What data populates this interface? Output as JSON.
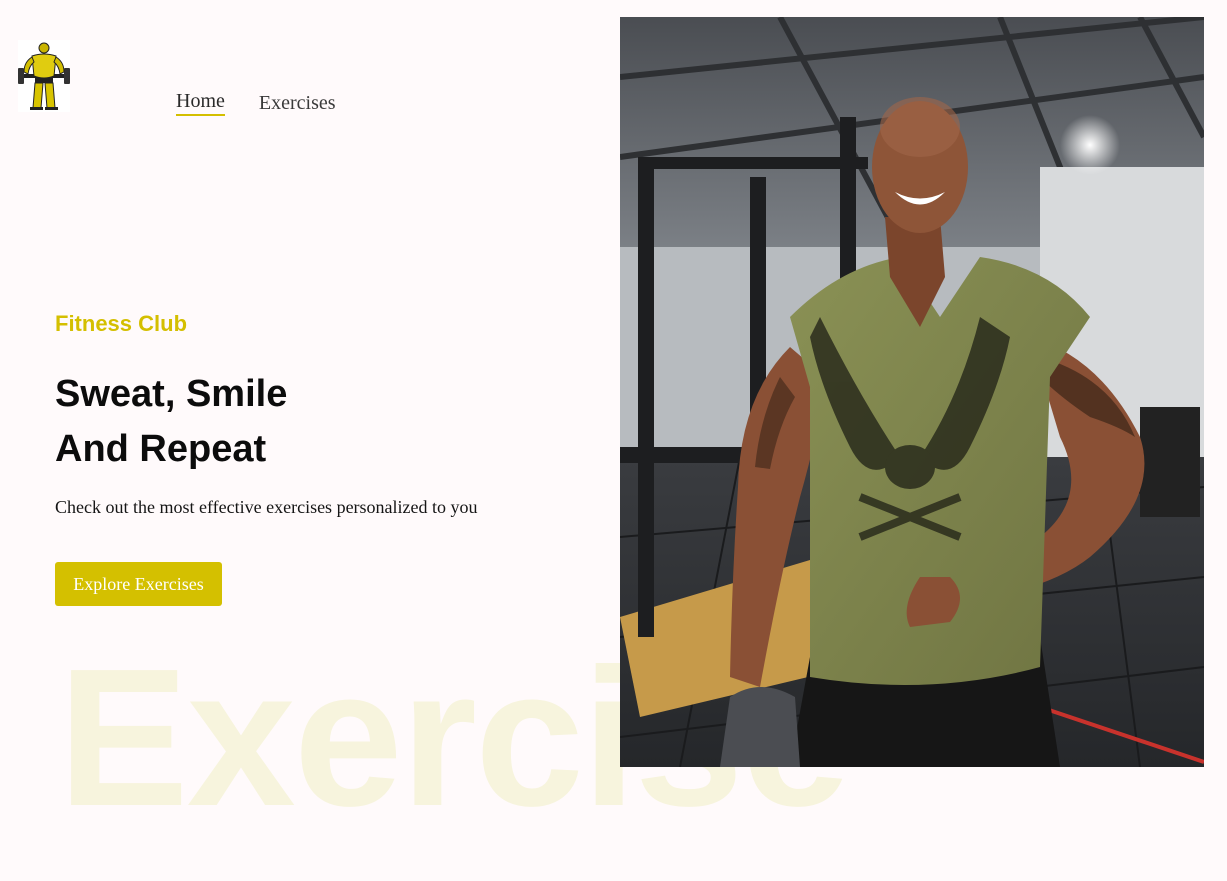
{
  "nav": {
    "items": [
      {
        "label": "Home",
        "active": true
      },
      {
        "label": "Exercises",
        "active": false
      }
    ]
  },
  "hero": {
    "eyebrow": "Fitness Club",
    "headline_line1": "Sweat, Smile",
    "headline_line2": "And Repeat",
    "subtext": "Check out the most effective exercises personalized to you",
    "cta_label": "Explore Exercises",
    "watermark": "Exercise",
    "image_description_icon": "gym-photo"
  },
  "colors": {
    "accent": "#d4bf00",
    "background": "#fffafb",
    "watermark": "#f7f4dd",
    "text": "#0c0c0c"
  }
}
